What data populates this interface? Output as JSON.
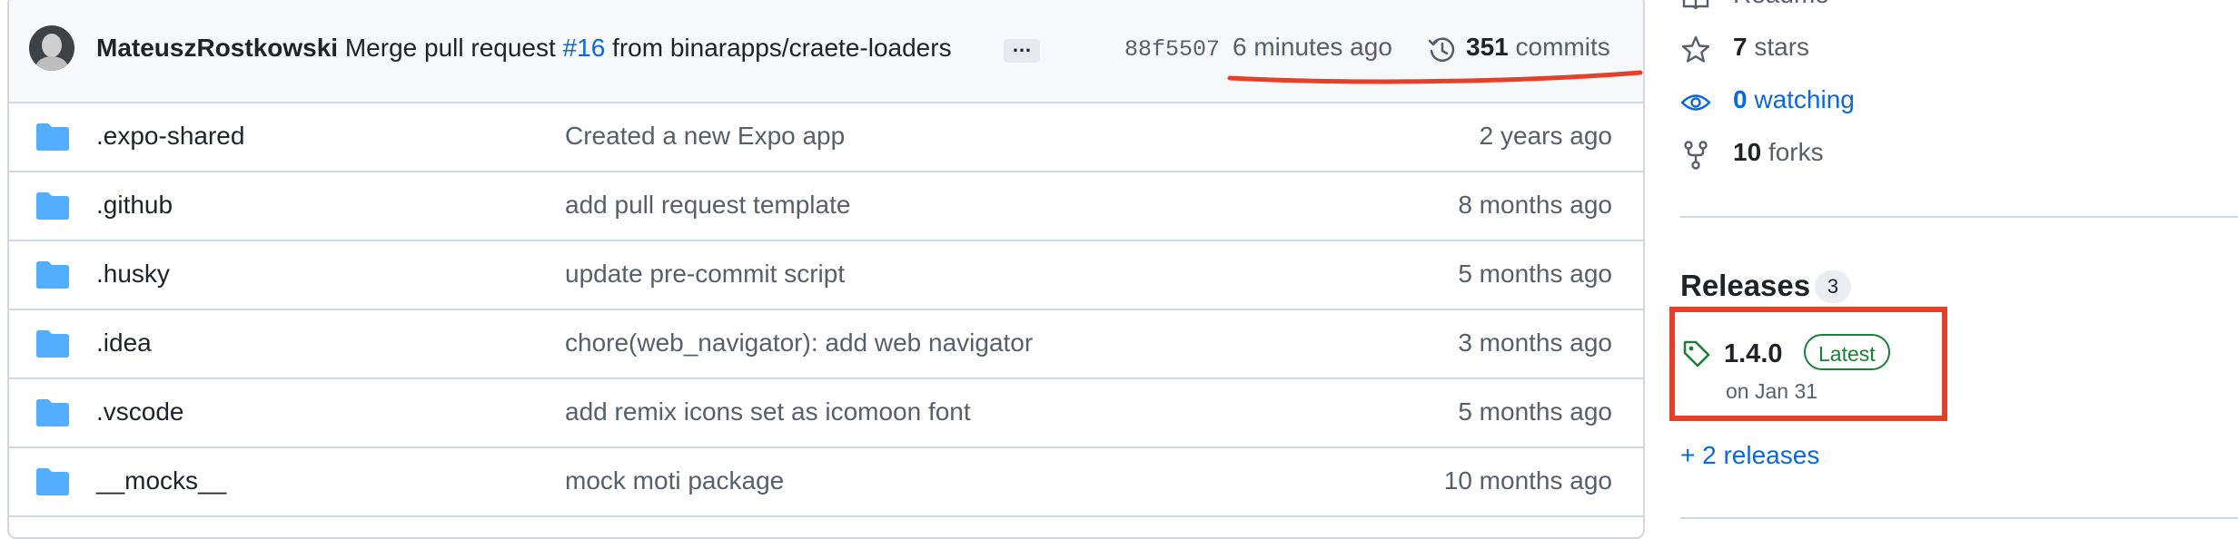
{
  "commit": {
    "author": "MateuszRostkowski",
    "message_prefix": "Merge pull request",
    "pr_number": "#16",
    "message_suffix": "from binarapps/craete-loaders",
    "ellipsis": "…",
    "sha": "88f5507",
    "time": "6 minutes ago",
    "commit_count": "351",
    "commit_label": "commits"
  },
  "files": [
    {
      "name": ".expo-shared",
      "message": "Created a new Expo app",
      "age": "2 years ago"
    },
    {
      "name": ".github",
      "message": "add pull request template",
      "age": "8 months ago"
    },
    {
      "name": ".husky",
      "message": "update pre-commit script",
      "age": "5 months ago"
    },
    {
      "name": ".idea",
      "message": "chore(web_navigator): add web navigator",
      "age": "3 months ago"
    },
    {
      "name": ".vscode",
      "message": "add remix icons set as icomoon font",
      "age": "5 months ago"
    },
    {
      "name": "__mocks__",
      "message": "mock moti package",
      "age": "10 months ago"
    }
  ],
  "sidebar": {
    "readme": "Readme",
    "stars_count": "7",
    "stars_label": "stars",
    "watching_count": "0",
    "watching_label": "watching",
    "forks_count": "10",
    "forks_label": "forks",
    "releases_title": "Releases",
    "releases_count": "3",
    "latest_version": "1.4.0",
    "latest_badge": "Latest",
    "latest_date": "on Jan 31",
    "more_releases": "+ 2 releases"
  },
  "colors": {
    "link": "#0969da",
    "muted": "#57606a",
    "folder": "#54aeff",
    "latest_green": "#1a7f37",
    "annotation_red": "#e5412a"
  },
  "icons": [
    "history-icon",
    "folder-icon",
    "book-icon",
    "star-icon",
    "eye-icon",
    "fork-icon",
    "tag-icon"
  ]
}
